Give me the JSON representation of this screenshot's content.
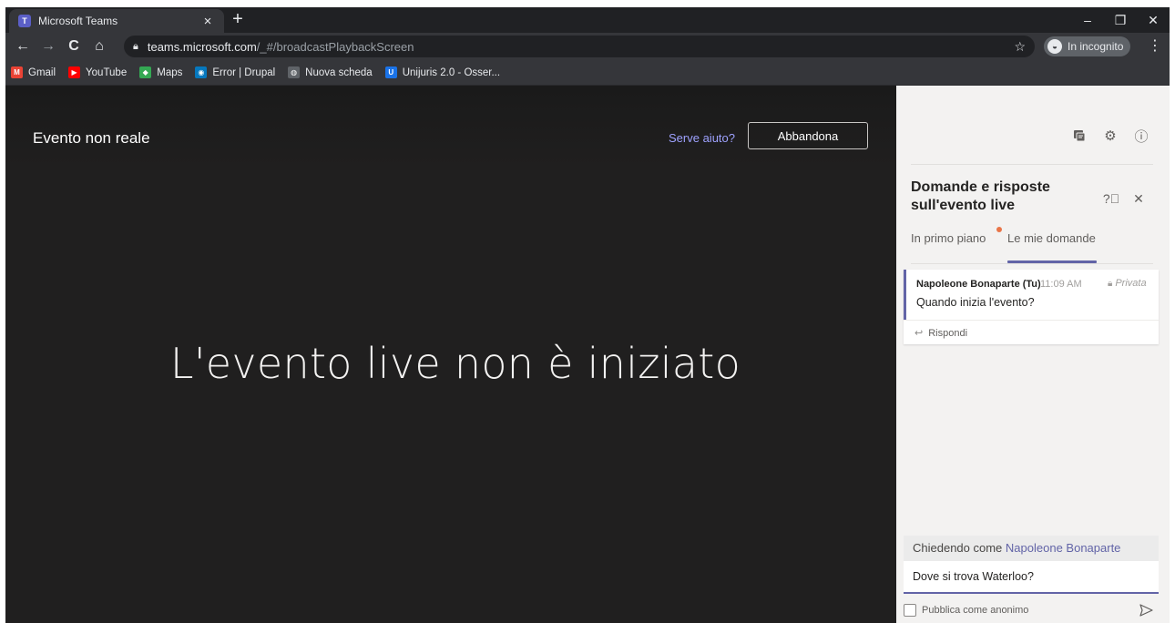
{
  "browser": {
    "tab_title": "Microsoft Teams",
    "tab_close": "×",
    "new_tab": "+",
    "window_controls": {
      "minimize": "–",
      "restore": "❐",
      "close": "✕"
    },
    "nav": {
      "back": "←",
      "forward": "→",
      "reload": "C",
      "home": "⌂"
    },
    "url_host": "teams.microsoft.com",
    "url_path": "/_#/broadcastPlaybackScreen",
    "incognito_label": "In incognito",
    "bookmarks": [
      {
        "label": "Gmail",
        "icon": "gmail-icon",
        "color": "#ea4335",
        "glyph": "M"
      },
      {
        "label": "YouTube",
        "icon": "youtube-icon",
        "color": "#ff0000",
        "glyph": "▶"
      },
      {
        "label": "Maps",
        "icon": "maps-icon",
        "color": "#34a853",
        "glyph": "◆"
      },
      {
        "label": "Error | Drupal",
        "icon": "drupal-icon",
        "color": "#0678be",
        "glyph": "◉"
      },
      {
        "label": "Nuova scheda",
        "icon": "globe-icon",
        "color": "#5f6368",
        "glyph": "◍"
      },
      {
        "label": "Unijuris 2.0 - Osser...",
        "icon": "unijuris-icon",
        "color": "#1a73e8",
        "glyph": "U"
      }
    ]
  },
  "event": {
    "title": "Evento non reale",
    "help_link": "Serve aiuto?",
    "leave_button": "Abbandona",
    "status_message": "L'evento live non è iniziato"
  },
  "qa": {
    "title": "Domande e risposte sull'evento live",
    "tabs": [
      {
        "label": "In primo piano",
        "has_dot": true
      },
      {
        "label": "Le mie domande",
        "selected": true
      }
    ],
    "questions": [
      {
        "author": "Napoleone Bonaparte (Tu)",
        "time": "11:09 AM",
        "visibility": "Privata",
        "text": "Quando inizia l'evento?",
        "reply_label": "Rispondi"
      }
    ],
    "compose": {
      "asking_prefix": "Chiedendo come",
      "asking_name": "Napoleone Bonaparte",
      "input_value": "Dove si trova Waterloo?",
      "anonymous_label": "Pubblica come anonimo"
    }
  },
  "colors": {
    "teams_accent": "#6264a7",
    "stage_bg": "#201f1f",
    "panel_bg": "#f3f2f1",
    "notification_dot": "#e97548"
  }
}
